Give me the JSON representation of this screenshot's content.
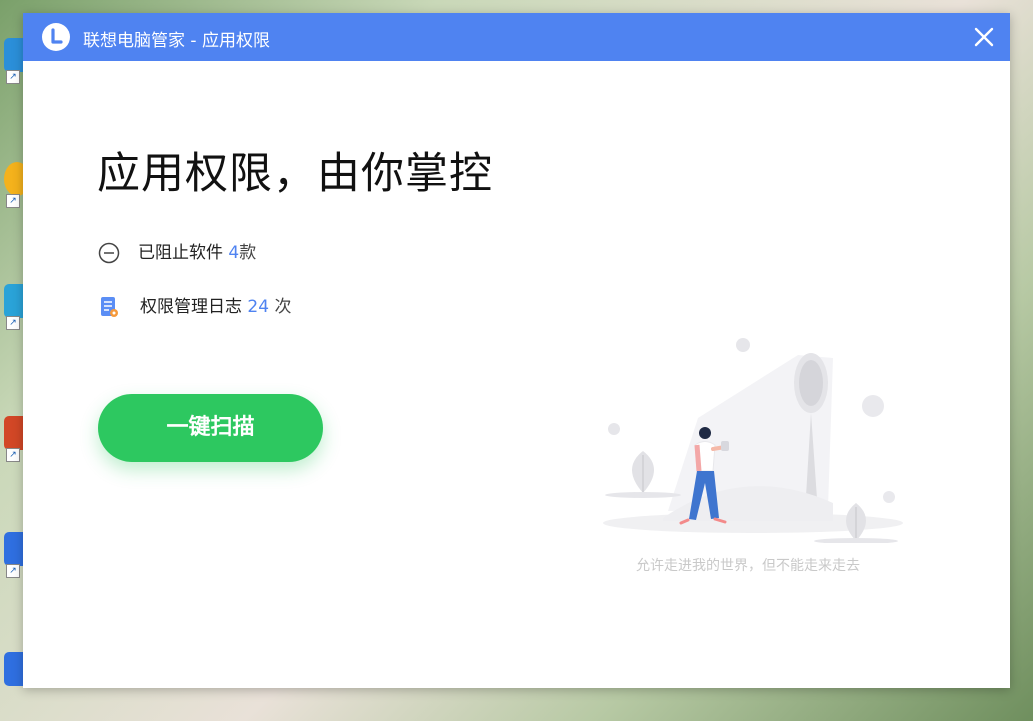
{
  "window": {
    "title": "联想电脑管家 - 应用权限",
    "close_icon": "close-icon",
    "logo_icon": "lenovo-logo-icon"
  },
  "hero": {
    "title": "应用权限，由你掌控"
  },
  "stats": {
    "blocked": {
      "label": "已阻止软件",
      "count": "4",
      "unit": "款",
      "icon": "minus-circle-icon"
    },
    "log": {
      "label": "权限管理日志",
      "count": "24",
      "unit": "次",
      "icon": "log-document-icon"
    }
  },
  "actions": {
    "scan_label": "一键扫描"
  },
  "illustration": {
    "caption": "允许走进我的世界，但不能走来走去"
  },
  "colors": {
    "titlebar": "#4f83f1",
    "accent_number": "#4f83f1",
    "scan_button": "#2dc860"
  }
}
